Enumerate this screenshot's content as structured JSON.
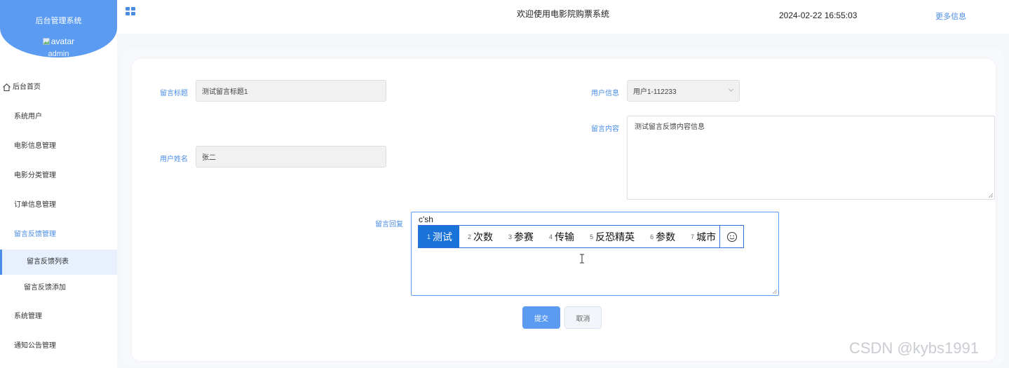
{
  "sidebar": {
    "system_name": "后台管理系统",
    "avatar_alt": "avatar",
    "username": "admin",
    "items": [
      {
        "label": "后台首页"
      },
      {
        "label": "系统用户"
      },
      {
        "label": "电影信息管理"
      },
      {
        "label": "电影分类管理"
      },
      {
        "label": "订单信息管理"
      },
      {
        "label": "留言反馈管理"
      },
      {
        "label": "留言反馈列表"
      },
      {
        "label": "留言反馈添加"
      },
      {
        "label": "系统管理"
      },
      {
        "label": "通知公告管理"
      }
    ]
  },
  "header": {
    "welcome": "欢迎使用电影院购票系统",
    "datetime": "2024-02-22 16:55:03",
    "more_info": "更多信息"
  },
  "form": {
    "title_label": "留言标题",
    "title_value": "测试留言标题1",
    "user_info_label": "用户信息",
    "user_info_value": "用户1-112233",
    "user_name_label": "用户姓名",
    "user_name_value": "张二",
    "content_label": "留言内容",
    "content_value": "测试留言反馈内容信息",
    "reply_label": "留言回复",
    "reply_value": "c'sh",
    "submit": "提交",
    "cancel": "取消"
  },
  "ime": {
    "candidates": [
      {
        "num": "1",
        "text": "测试"
      },
      {
        "num": "2",
        "text": "次数"
      },
      {
        "num": "3",
        "text": "参赛"
      },
      {
        "num": "4",
        "text": "传输"
      },
      {
        "num": "5",
        "text": "反恐精英"
      },
      {
        "num": "6",
        "text": "参数"
      },
      {
        "num": "7",
        "text": "城市"
      }
    ]
  },
  "watermark": "CSDN @kybs1991",
  "colors": {
    "accent": "#5b9bf2",
    "ime_highlight": "#1a73d9"
  }
}
